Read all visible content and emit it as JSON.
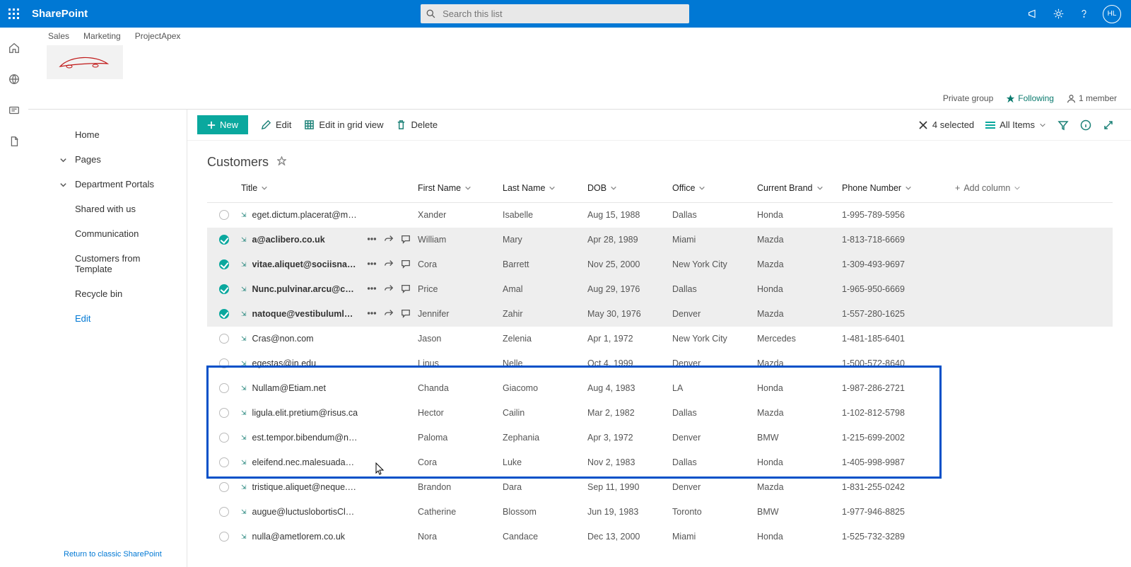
{
  "app_name": "SharePoint",
  "search": {
    "placeholder": "Search this list"
  },
  "avatar_initials": "HL",
  "hub_nav": [
    "Sales",
    "Marketing",
    "ProjectApex"
  ],
  "site_meta": {
    "privacy": "Private group",
    "following_label": "Following",
    "members_label": "1 member"
  },
  "left_nav": {
    "home": "Home",
    "pages": "Pages",
    "section": "Department Portals",
    "items": [
      "Shared with us",
      "Communication",
      "Customers from Template",
      "Recycle bin"
    ],
    "edit": "Edit",
    "return_link": "Return to classic SharePoint"
  },
  "cmd": {
    "new": "New",
    "edit": "Edit",
    "grid": "Edit in grid view",
    "delete": "Delete",
    "selected": "4 selected",
    "view": "All Items"
  },
  "list": {
    "title": "Customers"
  },
  "columns": {
    "title": "Title",
    "first": "First Name",
    "last": "Last Name",
    "dob": "DOB",
    "office": "Office",
    "brand": "Current Brand",
    "phone": "Phone Number",
    "add": "Add column"
  },
  "rows": [
    {
      "sel": false,
      "title": "eget.dictum.placerat@mattis.ca",
      "first": "Xander",
      "last": "Isabelle",
      "dob": "Aug 15, 1988",
      "office": "Dallas",
      "brand": "Honda",
      "phone": "1-995-789-5956"
    },
    {
      "sel": true,
      "title": "a@aclibero.co.uk",
      "first": "William",
      "last": "Mary",
      "dob": "Apr 28, 1989",
      "office": "Miami",
      "brand": "Mazda",
      "phone": "1-813-718-6669"
    },
    {
      "sel": true,
      "title": "vitae.aliquet@sociisnato...",
      "first": "Cora",
      "last": "Barrett",
      "dob": "Nov 25, 2000",
      "office": "New York City",
      "brand": "Mazda",
      "phone": "1-309-493-9697"
    },
    {
      "sel": true,
      "title": "Nunc.pulvinar.arcu@con...",
      "first": "Price",
      "last": "Amal",
      "dob": "Aug 29, 1976",
      "office": "Dallas",
      "brand": "Honda",
      "phone": "1-965-950-6669"
    },
    {
      "sel": true,
      "title": "natoque@vestibulumlor...",
      "first": "Jennifer",
      "last": "Zahir",
      "dob": "May 30, 1976",
      "office": "Denver",
      "brand": "Mazda",
      "phone": "1-557-280-1625"
    },
    {
      "sel": false,
      "title": "Cras@non.com",
      "first": "Jason",
      "last": "Zelenia",
      "dob": "Apr 1, 1972",
      "office": "New York City",
      "brand": "Mercedes",
      "phone": "1-481-185-6401"
    },
    {
      "sel": false,
      "title": "egestas@in.edu",
      "first": "Linus",
      "last": "Nelle",
      "dob": "Oct 4, 1999",
      "office": "Denver",
      "brand": "Mazda",
      "phone": "1-500-572-8640"
    },
    {
      "sel": false,
      "title": "Nullam@Etiam.net",
      "first": "Chanda",
      "last": "Giacomo",
      "dob": "Aug 4, 1983",
      "office": "LA",
      "brand": "Honda",
      "phone": "1-987-286-2721"
    },
    {
      "sel": false,
      "title": "ligula.elit.pretium@risus.ca",
      "first": "Hector",
      "last": "Cailin",
      "dob": "Mar 2, 1982",
      "office": "Dallas",
      "brand": "Mazda",
      "phone": "1-102-812-5798"
    },
    {
      "sel": false,
      "title": "est.tempor.bibendum@neccursusa.com",
      "first": "Paloma",
      "last": "Zephania",
      "dob": "Apr 3, 1972",
      "office": "Denver",
      "brand": "BMW",
      "phone": "1-215-699-2002"
    },
    {
      "sel": false,
      "title": "eleifend.nec.malesuada@atrisus.ca",
      "first": "Cora",
      "last": "Luke",
      "dob": "Nov 2, 1983",
      "office": "Dallas",
      "brand": "Honda",
      "phone": "1-405-998-9987"
    },
    {
      "sel": false,
      "title": "tristique.aliquet@neque.co.uk",
      "first": "Brandon",
      "last": "Dara",
      "dob": "Sep 11, 1990",
      "office": "Denver",
      "brand": "Mazda",
      "phone": "1-831-255-0242"
    },
    {
      "sel": false,
      "title": "augue@luctuslobortisClass.co.uk",
      "first": "Catherine",
      "last": "Blossom",
      "dob": "Jun 19, 1983",
      "office": "Toronto",
      "brand": "BMW",
      "phone": "1-977-946-8825"
    },
    {
      "sel": false,
      "title": "nulla@ametlorem.co.uk",
      "first": "Nora",
      "last": "Candace",
      "dob": "Dec 13, 2000",
      "office": "Miami",
      "brand": "Honda",
      "phone": "1-525-732-3289"
    }
  ]
}
